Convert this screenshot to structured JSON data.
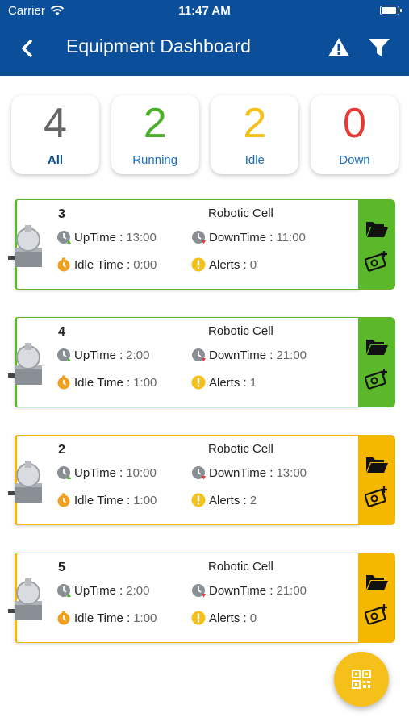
{
  "status_bar": {
    "carrier": "Carrier",
    "time": "11:47 AM"
  },
  "header": {
    "title": "Equipment Dashboard"
  },
  "icons": {
    "back": "chevron-left-icon",
    "alert": "warning-icon",
    "filter": "filter-icon",
    "folder": "folder-open-icon",
    "settings": "gear-camera-icon",
    "qr": "qr-code-icon"
  },
  "summary": [
    {
      "count": "4",
      "label": "All",
      "color": "#666666"
    },
    {
      "count": "2",
      "label": "Running",
      "color": "#4caf2a"
    },
    {
      "count": "2",
      "label": "Idle",
      "color": "#f5c01a"
    },
    {
      "count": "0",
      "label": "Down",
      "color": "#e23b35"
    }
  ],
  "labels": {
    "uptime": "UpTime :",
    "downtime": "DownTime :",
    "idle_time": "Idle Time :",
    "alerts": "Alerts :"
  },
  "colors": {
    "header": "#0b4f9a",
    "running": "#5bb82a",
    "idle": "#f5b800",
    "fab": "#f5c01a"
  },
  "equipment": [
    {
      "id": "3",
      "name": "Robotic Cell",
      "uptime": "13:00",
      "downtime": "11:00",
      "idle_time": "0:00",
      "alerts": "0",
      "status": "running"
    },
    {
      "id": "4",
      "name": "Robotic Cell",
      "uptime": "2:00",
      "downtime": "21:00",
      "idle_time": "1:00",
      "alerts": "1",
      "status": "running"
    },
    {
      "id": "2",
      "name": "Robotic Cell",
      "uptime": "10:00",
      "downtime": "13:00",
      "idle_time": "1:00",
      "alerts": "2",
      "status": "idle"
    },
    {
      "id": "5",
      "name": "Robotic Cell",
      "uptime": "2:00",
      "downtime": "21:00",
      "idle_time": "1:00",
      "alerts": "0",
      "status": "idle"
    }
  ]
}
